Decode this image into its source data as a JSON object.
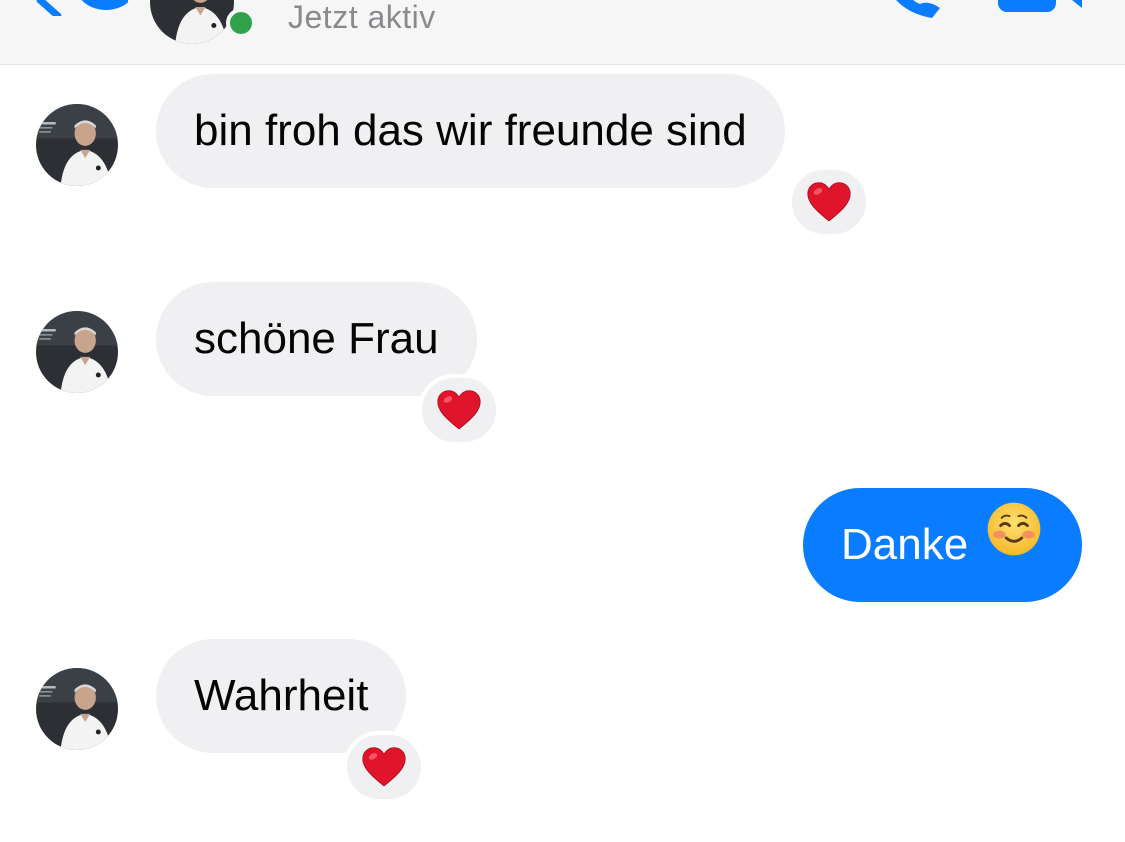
{
  "header": {
    "status_text": "Jetzt aktiv",
    "online": true
  },
  "messages": [
    {
      "direction": "incoming",
      "text": "bin froh das wir freunde sind",
      "reaction": "red-heart"
    },
    {
      "direction": "incoming",
      "text": "schöne Frau",
      "reaction": "red-heart"
    },
    {
      "direction": "outgoing",
      "text": "Danke",
      "emoji": "smiling-face-emoji"
    },
    {
      "direction": "incoming",
      "text": "Wahrheit",
      "reaction": "red-heart"
    }
  ],
  "colors": {
    "outgoing_bubble": "#0a7cff",
    "incoming_bubble": "#f0f0f2",
    "accent": "#0a7cff",
    "online_dot": "#31a24c",
    "status_text": "#8a8a8e"
  }
}
